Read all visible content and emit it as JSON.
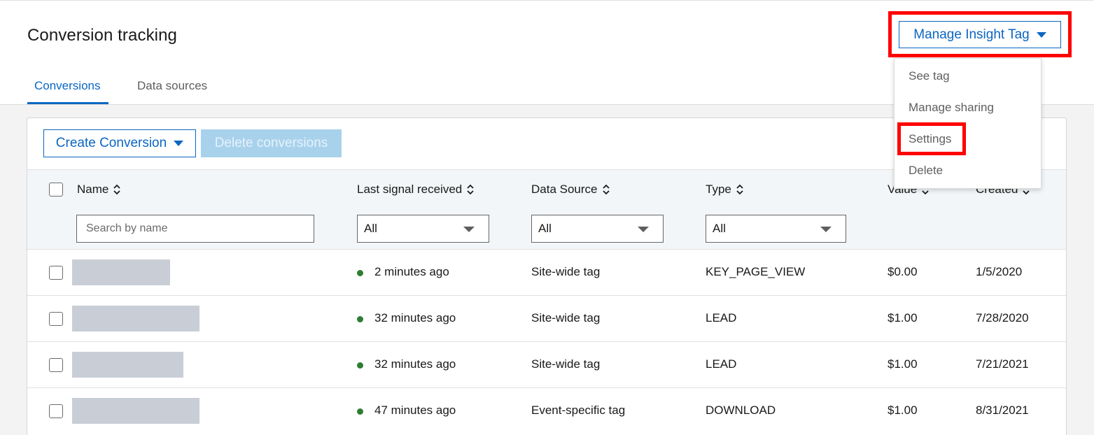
{
  "header": {
    "title": "Conversion tracking",
    "manage_button": "Manage Insight Tag",
    "tabs": [
      {
        "label": "Conversions",
        "active": true
      },
      {
        "label": "Data sources",
        "active": false
      }
    ]
  },
  "manage_menu": {
    "items": [
      "See tag",
      "Manage sharing",
      "Settings",
      "Delete"
    ],
    "highlighted": "Settings"
  },
  "toolbar": {
    "create_label": "Create Conversion",
    "delete_label": "Delete conversions"
  },
  "table": {
    "columns": [
      "Name",
      "Last signal received",
      "Data Source",
      "Type",
      "Value",
      "Created"
    ],
    "filters": {
      "search_placeholder": "Search by name",
      "last_signal": "All",
      "data_source": "All",
      "type": "All"
    },
    "rows": [
      {
        "last_signal": "2 minutes ago",
        "data_source": "Site-wide tag",
        "type": "KEY_PAGE_VIEW",
        "value": "$0.00",
        "created": "1/5/2020"
      },
      {
        "last_signal": "32 minutes ago",
        "data_source": "Site-wide tag",
        "type": "LEAD",
        "value": "$1.00",
        "created": "7/28/2020"
      },
      {
        "last_signal": "32 minutes ago",
        "data_source": "Site-wide tag",
        "type": "LEAD",
        "value": "$1.00",
        "created": "7/21/2021"
      },
      {
        "last_signal": "47 minutes ago",
        "data_source": "Event-specific tag",
        "type": "DOWNLOAD",
        "value": "$1.00",
        "created": "8/31/2021"
      }
    ]
  },
  "colors": {
    "accent": "#0a66c2",
    "highlight": "#ff0000",
    "status_dot": "#2e7d32"
  },
  "icons": {
    "sort": "sort-chevrons-icon",
    "dropdown": "caret-down-icon"
  }
}
